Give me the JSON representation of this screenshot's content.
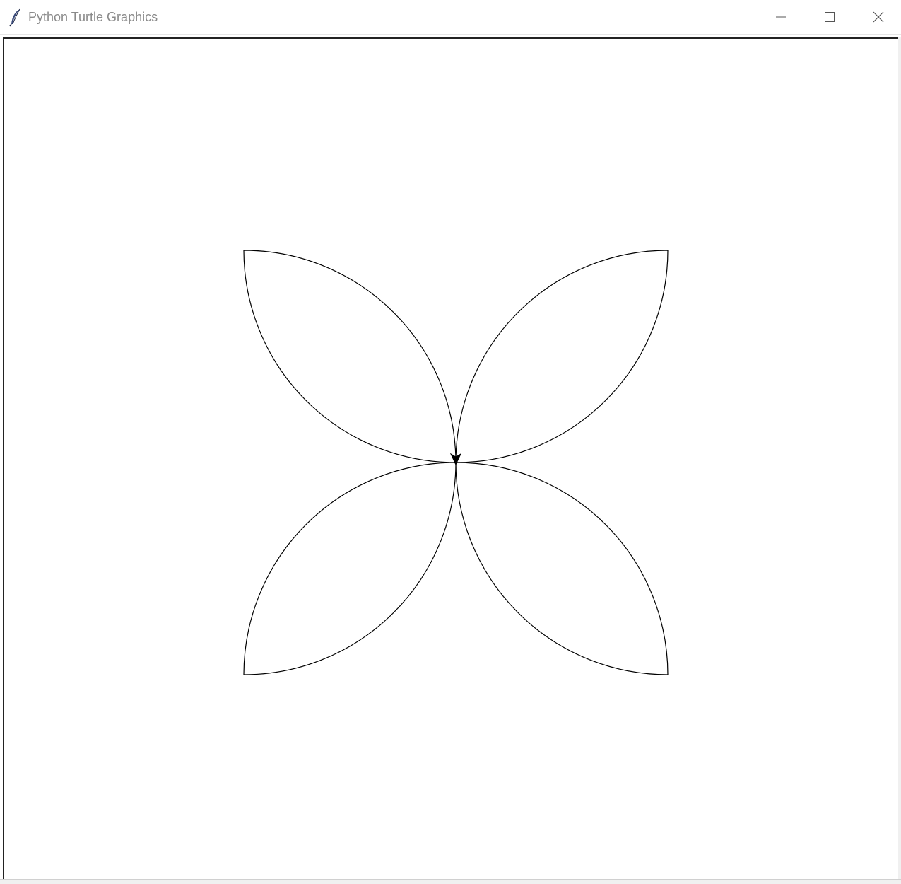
{
  "window": {
    "title": "Python Turtle Graphics",
    "icon": "feather-icon"
  },
  "controls": {
    "minimize": "minimize-icon",
    "maximize": "maximize-icon",
    "close": "close-icon"
  },
  "canvas": {
    "background": "#ffffff",
    "pen_color": "#000000",
    "shape": "four-petal flower made of circular arcs",
    "petal_count": 4,
    "turtle_heading": "down"
  }
}
